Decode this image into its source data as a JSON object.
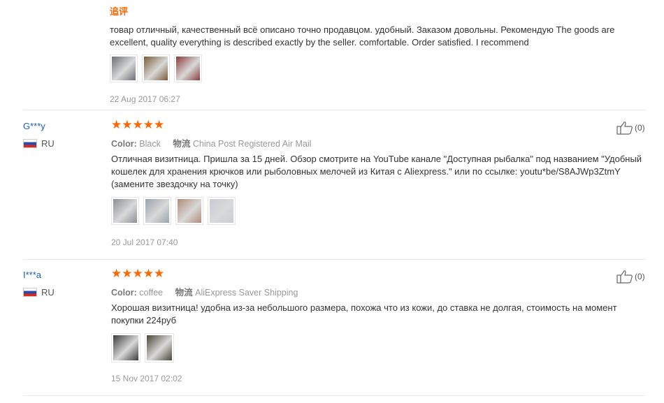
{
  "review0": {
    "append_label": "追评",
    "text": "товар отличный, качественный всё описано точно продавцом. удобный. Заказом довольны. Рекомендую The goods are excellent, quality everything is described exactly by the seller. comfortable. Order satisfied. I recommend",
    "thumbs": [
      "#6b6f75",
      "#7a5a38",
      "#8a3b3b"
    ],
    "date": "22 Aug 2017 06:27"
  },
  "review1": {
    "user": "G***y",
    "country": "RU",
    "stars": "★★★★★",
    "color_label": "Color:",
    "color_value": "Black",
    "shipping_label": "物流",
    "shipping_value": "China Post Registered Air Mail",
    "likes": "(0)",
    "text": "Отличная визитница. Пришла за 15 дней. Обзор смотрите на YouTube канале \"Доступная рыбалка\" под названием \"Удобный кошелек для хранения крючков или рыболовных мелочей из Китая с Aliexpress.\" или по ссылке: youtu*be/S8AJWp3ZtmY (замените звездочку на точку)",
    "thumbs": [
      "#8a8f96",
      "#9aa3ad",
      "#b08a78",
      "#c8ccd4"
    ],
    "date": "20 Jul 2017 07:40"
  },
  "review2": {
    "user": "I***a",
    "country": "RU",
    "stars": "★★★★★",
    "color_label": "Color:",
    "color_value": "coffee",
    "shipping_label": "物流",
    "shipping_value": "AliExpress Saver Shipping",
    "likes": "(0)",
    "text": "Хорошая визитница! удобна из-за небольшого размера, похожа что из кожи, до ставка не долгая, стоимость на момент покупки 224руб",
    "thumbs": [
      "#3a3a3a",
      "#4a4538"
    ],
    "date": "15 Nov 2017 02:02"
  },
  "colors": {
    "accent": "#ff6600",
    "username": "#1a5fb4",
    "muted": "#999999"
  }
}
